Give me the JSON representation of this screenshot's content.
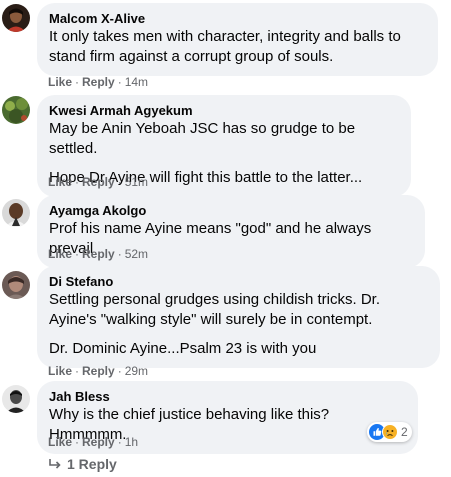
{
  "comments": [
    {
      "author": "Malcom X-Alive",
      "paragraphs": [
        "It only takes men with character, integrity and balls to stand firm against a corrupt group of souls."
      ],
      "like": "Like",
      "reply": "Reply",
      "time": "14m"
    },
    {
      "author": "Kwesi Armah Agyekum",
      "paragraphs": [
        "May be Anin Yeboah JSC has so grudge to be settled.",
        "Hope Dr Ayine will fight this battle to the latter..."
      ],
      "like": "Like",
      "reply": "Reply",
      "time": "51m"
    },
    {
      "author": "Ayamga Akolgo",
      "paragraphs": [
        "Prof his name Ayine means \"god\" and he always prevail"
      ],
      "like": "Like",
      "reply": "Reply",
      "time": "52m"
    },
    {
      "author": "Di Stefano",
      "paragraphs": [
        "Settling personal grudges using childish tricks. Dr. Ayine's \"walking style\" will surely be in contempt.",
        "Dr. Dominic Ayine...Psalm 23 is with you"
      ],
      "like": "Like",
      "reply": "Reply",
      "time": "29m"
    },
    {
      "author": "Jah Bless",
      "paragraphs": [
        "Why is the chief justice behaving like this? Hmmmmm."
      ],
      "like": "Like",
      "reply": "Reply",
      "time": "1h",
      "reactions": {
        "icons": [
          "like-reaction-icon",
          "sad-reaction-icon"
        ],
        "count": "2"
      }
    }
  ],
  "replies_link": "1 Reply",
  "colors": {
    "bubble": "#f0f2f5",
    "meta": "#65676b",
    "text": "#050505",
    "like_blue": "#1877f2",
    "sad_yellow": "#f7b125"
  }
}
